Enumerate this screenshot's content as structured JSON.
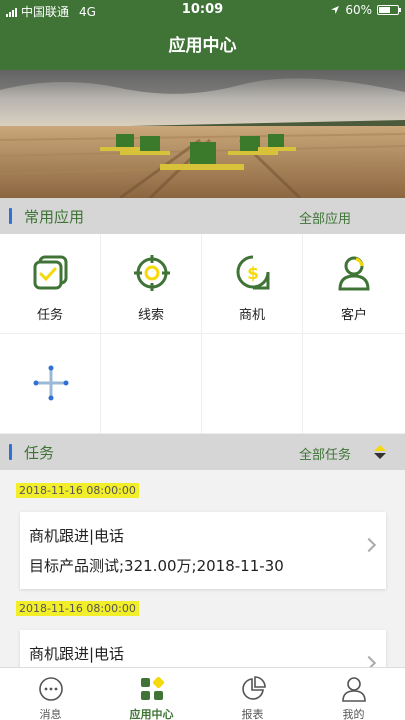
{
  "status_bar": {
    "carrier": "中国联通",
    "network": "4G",
    "time": "10:09",
    "battery": "60%",
    "battery_level": 0.6
  },
  "nav": {
    "title": "应用中心"
  },
  "banner": {
    "alt": "combine harvesters"
  },
  "apps_section": {
    "title": "常用应用",
    "more_label": "全部应用",
    "items": [
      {
        "label": "任务",
        "icon": "task-icon"
      },
      {
        "label": "线索",
        "icon": "target-icon"
      },
      {
        "label": "商机",
        "icon": "dollar-chat-icon"
      },
      {
        "label": "客户",
        "icon": "customer-icon"
      }
    ],
    "add_icon": "plus-icon"
  },
  "tasks_section": {
    "title": "任务",
    "more_label": "全部任务",
    "items": [
      {
        "date": "2018-11-16 08:00:00",
        "title": "商机跟进|电话",
        "detail": "目标产品测试;321.00万;2018-11-30"
      },
      {
        "date": "2018-11-16 08:00:00",
        "title": "商机跟进|电话",
        "detail": ""
      }
    ]
  },
  "tabbar": {
    "items": [
      {
        "label": "消息",
        "icon": "chat-icon"
      },
      {
        "label": "应用中心",
        "icon": "apps-icon",
        "active": true
      },
      {
        "label": "报表",
        "icon": "pie-chart-icon"
      },
      {
        "label": "我的",
        "icon": "user-icon"
      }
    ]
  },
  "colors": {
    "brand_green": "#3f7436",
    "accent_yellow": "#f5d90a",
    "highlight": "#f3ee2a",
    "blue_bar": "#2f6fd6"
  }
}
